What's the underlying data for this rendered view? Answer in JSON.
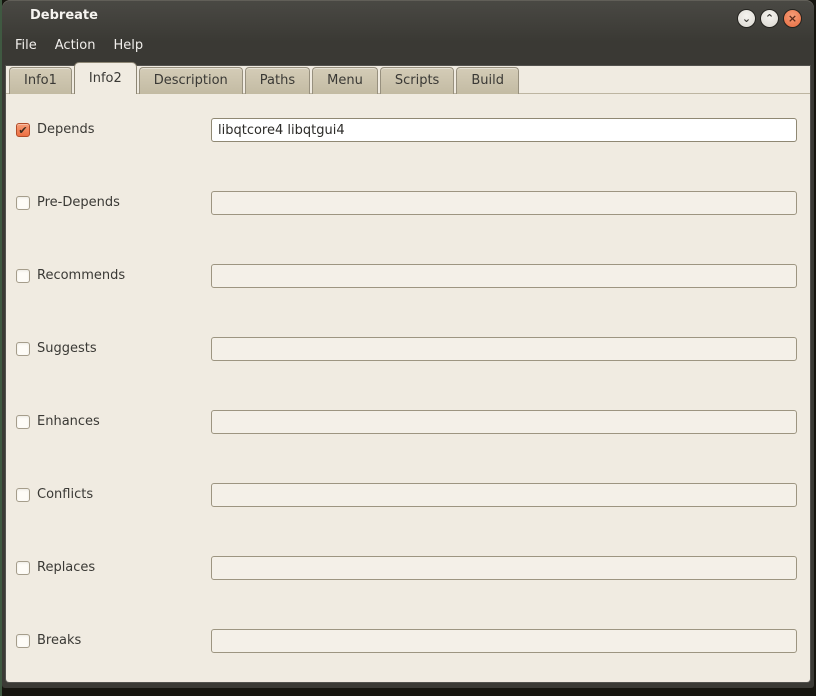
{
  "window": {
    "title": "Debreate",
    "controls": {
      "minimize_glyph": "⌄",
      "maximize_glyph": "⌃",
      "close_glyph": "×"
    }
  },
  "menubar": {
    "items": [
      {
        "label": "File"
      },
      {
        "label": "Action"
      },
      {
        "label": "Help"
      }
    ]
  },
  "tabs": [
    {
      "label": "Info1",
      "active": false
    },
    {
      "label": "Info2",
      "active": true
    },
    {
      "label": "Description",
      "active": false
    },
    {
      "label": "Paths",
      "active": false
    },
    {
      "label": "Menu",
      "active": false
    },
    {
      "label": "Scripts",
      "active": false
    },
    {
      "label": "Build",
      "active": false
    }
  ],
  "form": {
    "rows": [
      {
        "label": "Depends",
        "checked": true,
        "check": "✔",
        "value": "libqtcore4 libqtgui4",
        "disabled": false
      },
      {
        "label": "Pre-Depends",
        "checked": false,
        "check": "",
        "value": "",
        "disabled": true
      },
      {
        "label": "Recommends",
        "checked": false,
        "check": "",
        "value": "",
        "disabled": true
      },
      {
        "label": "Suggests",
        "checked": false,
        "check": "",
        "value": "",
        "disabled": true
      },
      {
        "label": "Enhances",
        "checked": false,
        "check": "",
        "value": "",
        "disabled": true
      },
      {
        "label": "Conflicts",
        "checked": false,
        "check": "",
        "value": "",
        "disabled": true
      },
      {
        "label": "Replaces",
        "checked": false,
        "check": "",
        "value": "",
        "disabled": true
      },
      {
        "label": "Breaks",
        "checked": false,
        "check": "",
        "value": "",
        "disabled": true
      }
    ]
  },
  "colors": {
    "accent": "#ec6f42",
    "titlebar": "#3b3a35",
    "panel": "#f0ebe1",
    "tab_inactive": "#c9c1ab",
    "close_button": "#e76c40"
  }
}
